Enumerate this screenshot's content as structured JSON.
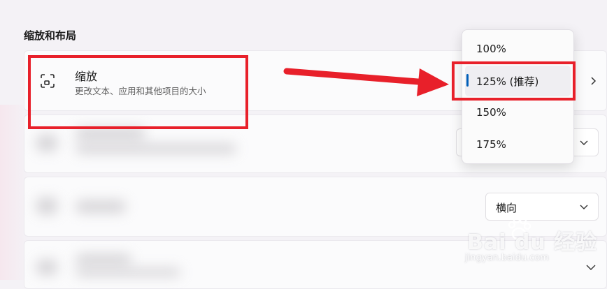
{
  "section": {
    "title": "缩放和布局"
  },
  "zoom_setting": {
    "icon": "zoom-frame-icon",
    "title": "缩放",
    "description": "更改文本、应用和其他项目的大小"
  },
  "zoom_menu": {
    "options": [
      {
        "label": "100%"
      },
      {
        "label": "125% (推荐)",
        "selected": true
      },
      {
        "label": "150%"
      },
      {
        "label": "175%"
      }
    ]
  },
  "orientation": {
    "value": "横向"
  },
  "annotation": {
    "color": "#e8202a"
  },
  "accent_color": "#005fb8",
  "watermark": {
    "logo": "Bai du 经验",
    "url": "jingyan.baidu.com"
  }
}
